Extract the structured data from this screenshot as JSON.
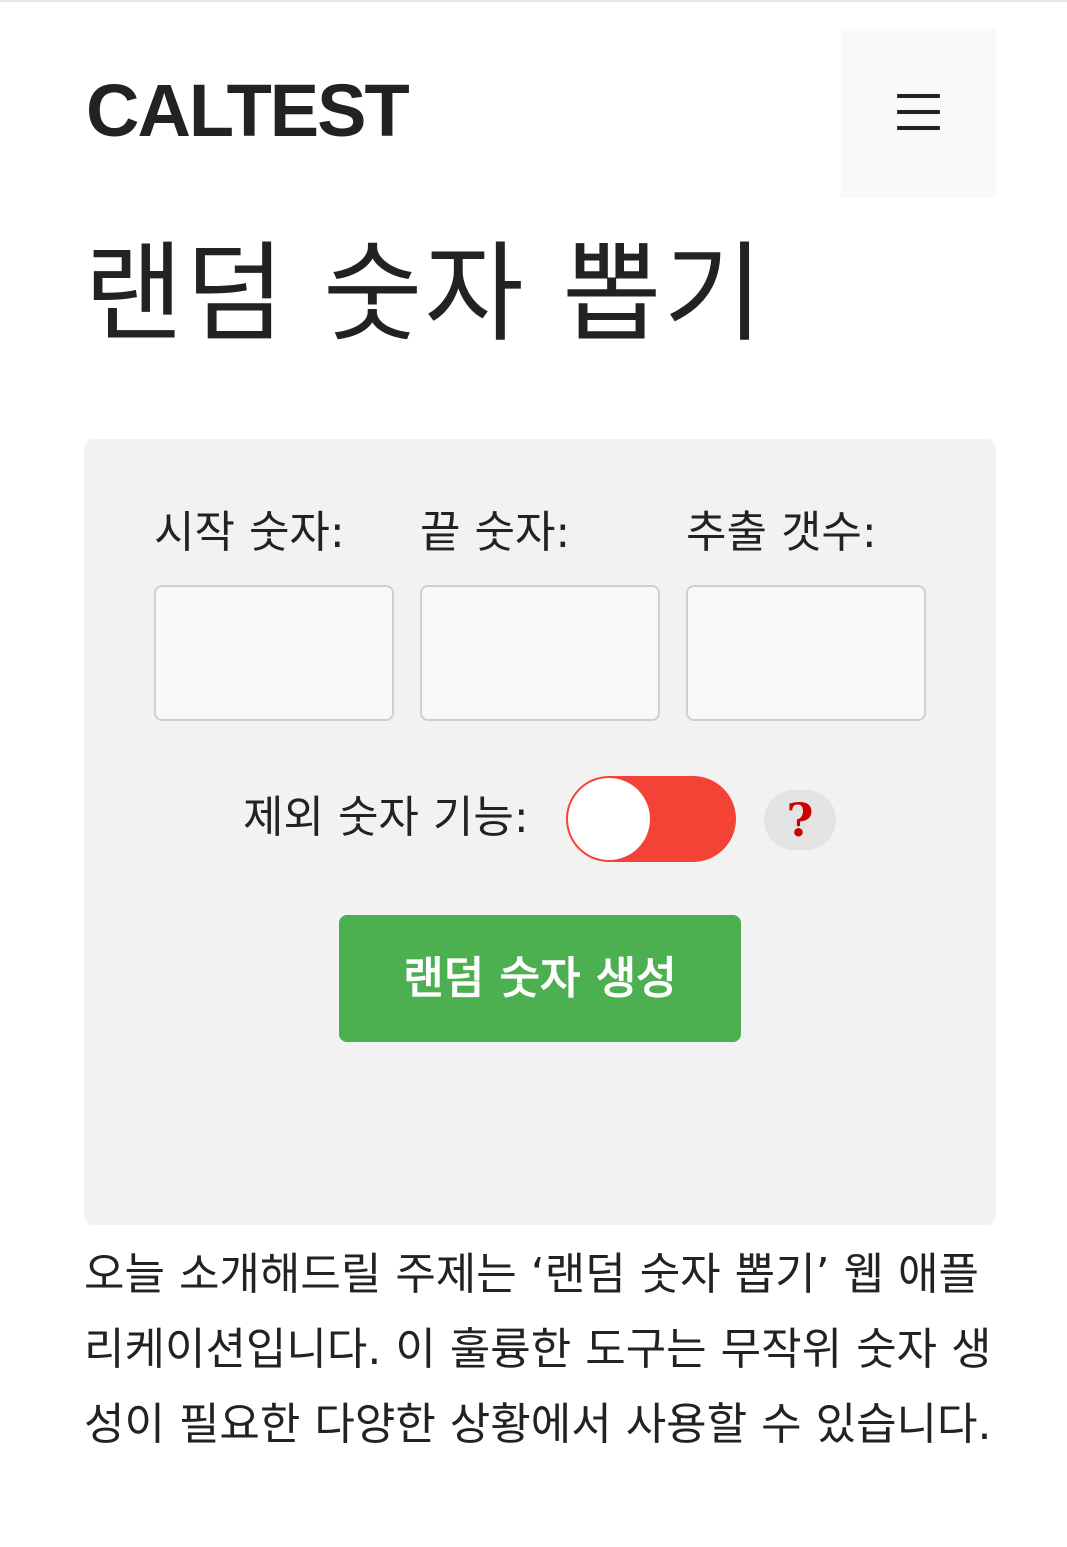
{
  "header": {
    "logo": "CALTEST",
    "menu_icon": "hamburger-menu-icon"
  },
  "page": {
    "title": "랜덤 숫자 뽑기"
  },
  "form": {
    "start_label": "시작 숫자:",
    "start_value": "",
    "end_label": "끝 숫자:",
    "end_value": "",
    "count_label": "추출 갯수:",
    "count_value": "",
    "exclude_label": "제외 숫자 기능:",
    "exclude_enabled": false,
    "help_icon": "question-mark-icon",
    "help_text": "?",
    "generate_label": "랜덤 숫자 생성"
  },
  "colors": {
    "toggle_off": "#f44336",
    "button_green": "#4caf50",
    "help_red": "#cc0000",
    "card_bg": "#f2f2f2"
  },
  "content": {
    "intro": "오늘 소개해드릴 주제는 ‘랜덤 숫자 뽑기’ 웹 애플리케이션입니다. 이 훌륭한 도구는 무작위 숫자 생성이 필요한 다양한 상황에서 사용할 수 있습니다."
  }
}
